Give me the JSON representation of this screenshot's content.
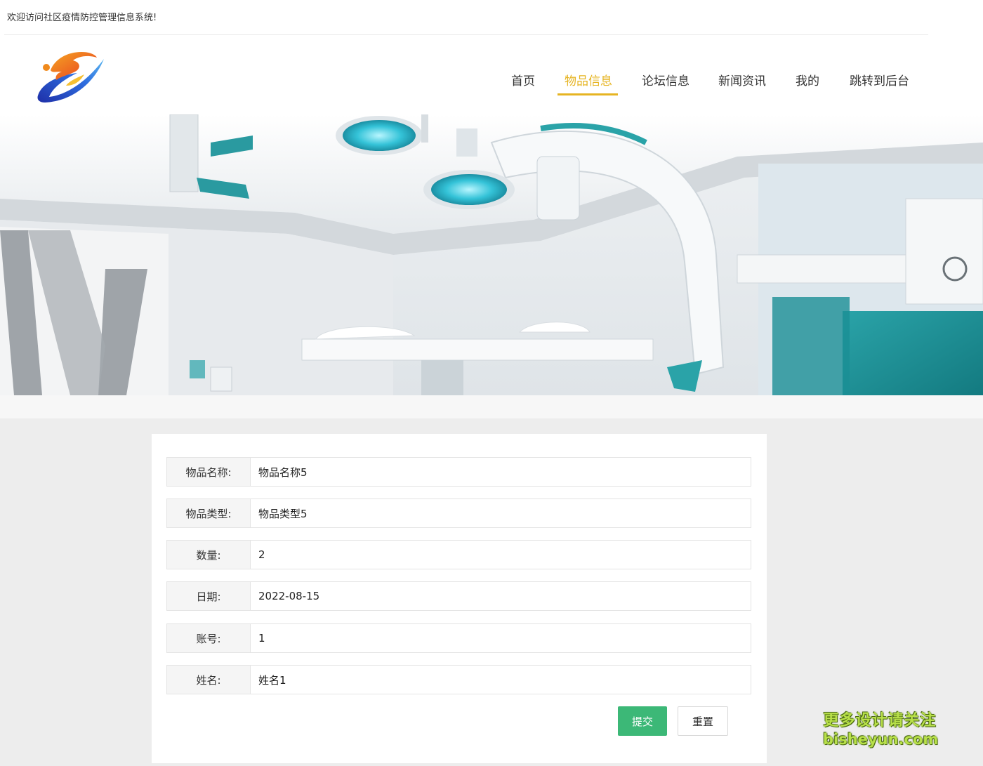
{
  "header": {
    "welcome_text": "欢迎访问社区疫情防控管理信息系统!"
  },
  "nav": {
    "items": [
      {
        "label": "首页",
        "active": false
      },
      {
        "label": "物品信息",
        "active": true
      },
      {
        "label": "论坛信息",
        "active": false
      },
      {
        "label": "新闻资讯",
        "active": false
      },
      {
        "label": "我的",
        "active": false
      },
      {
        "label": "跳转到后台",
        "active": false
      }
    ],
    "active_color": "#e6b422"
  },
  "banner": {
    "description_icon": "operating-room-banner-image"
  },
  "form": {
    "fields": [
      {
        "label": "物品名称:",
        "value": "物品名称5"
      },
      {
        "label": "物品类型:",
        "value": "物品类型5"
      },
      {
        "label": "数量:",
        "value": "2"
      },
      {
        "label": "日期:",
        "value": "2022-08-15"
      },
      {
        "label": "账号:",
        "value": "1"
      },
      {
        "label": "姓名:",
        "value": "姓名1"
      }
    ],
    "submit_label": "提交",
    "reset_label": "重置",
    "submit_color": "#3cb877"
  },
  "watermark": {
    "line1": "更多设计请关注",
    "line2": "bisheyun.com"
  }
}
